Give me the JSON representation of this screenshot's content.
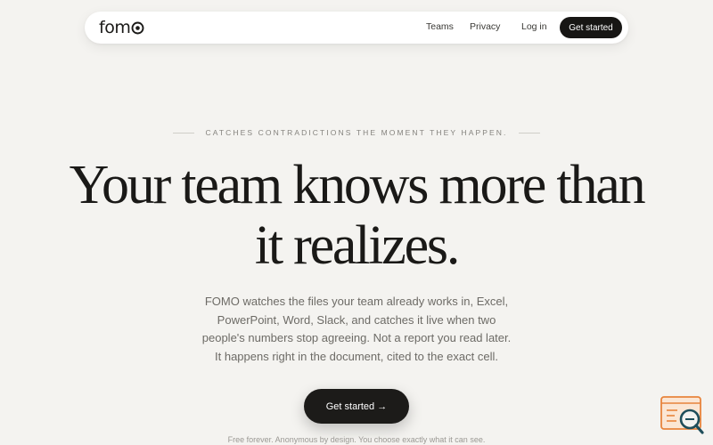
{
  "nav": {
    "logo": "fomo",
    "links": [
      "Teams",
      "Privacy",
      "Log in"
    ],
    "cta": "Get started"
  },
  "hero": {
    "eyebrow": "Catches contradictions the moment they happen.",
    "headline_lines": [
      "Your team knows more than",
      "it realizes."
    ],
    "sub_lines": [
      "FOMO watches the files your team already works in, Excel,",
      "PowerPoint, Word, Slack, and catches it live when two",
      "people's numbers stop agreeing. Not a report you read later.",
      "It happens right in the document, cited to the exact cell."
    ],
    "cta": "Get started →",
    "footnote": "Free forever. Anonymous by design. You choose exactly what it can see."
  },
  "colors": {
    "background": "#f4f3f0",
    "dark": "#1a1917",
    "accent_orange": "#e8843c",
    "widget_teal": "#1f4e5a"
  },
  "icons": {
    "widget": "search-document-icon"
  }
}
